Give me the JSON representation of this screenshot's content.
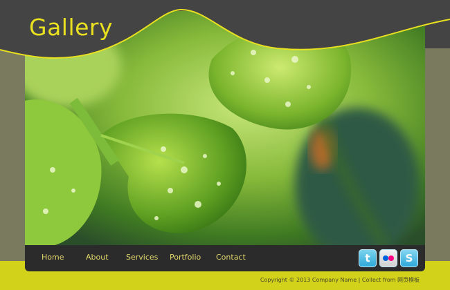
{
  "header": {
    "title": "Gallery"
  },
  "nav": {
    "items": [
      {
        "label": "Home"
      },
      {
        "label": "About"
      },
      {
        "label": "Services"
      },
      {
        "label": "Portfolio"
      },
      {
        "label": "Contact"
      }
    ]
  },
  "social": {
    "twitter_glyph": "t",
    "skype_glyph": "S"
  },
  "footer": {
    "copyright": "Copyright © 2013 Company Name | Collect from 网页模板"
  },
  "colors": {
    "accent": "#e9e020",
    "header_bg": "#444444",
    "side_bg": "#7a7a5e",
    "footer_bg": "#d2d21a",
    "nav_bg": "#2b2b2b",
    "nav_text": "#e0d76a"
  }
}
